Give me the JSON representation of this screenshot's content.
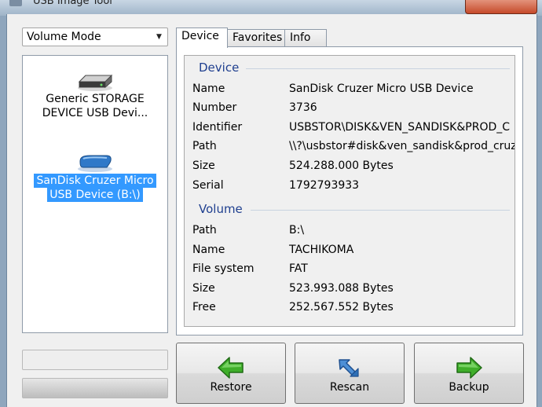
{
  "window": {
    "title": "USB Image Tool"
  },
  "mode_select": {
    "value": "Volume Mode"
  },
  "devices": [
    {
      "label_line1": "Generic STORAGE",
      "label_line2": "DEVICE USB Devi...",
      "selected": false,
      "icon": "usb-drive-gray-icon"
    },
    {
      "label_line1": "SanDisk Cruzer Micro",
      "label_line2": "USB Device (B:\\)",
      "selected": true,
      "icon": "usb-drive-blue-icon"
    }
  ],
  "tabs": [
    {
      "label": "Device",
      "active": true
    },
    {
      "label": "Favorites",
      "active": false
    },
    {
      "label": "Info",
      "active": false
    }
  ],
  "device_group": {
    "title": "Device",
    "rows": [
      {
        "label": "Name",
        "value": "SanDisk Cruzer Micro USB Device"
      },
      {
        "label": "Number",
        "value": "3736"
      },
      {
        "label": "Identifier",
        "value": "USBSTOR\\DISK&VEN_SANDISK&PROD_C"
      },
      {
        "label": "Path",
        "value": "\\\\?\\usbstor#disk&ven_sandisk&prod_cruzer_"
      },
      {
        "label": "Size",
        "value": "524.288.000 Bytes"
      },
      {
        "label": "Serial",
        "value": "1792793933"
      }
    ]
  },
  "volume_group": {
    "title": "Volume",
    "rows": [
      {
        "label": "Path",
        "value": "B:\\"
      },
      {
        "label": "Name",
        "value": "TACHIKOMA"
      },
      {
        "label": "File system",
        "value": "FAT"
      },
      {
        "label": "Size",
        "value": "523.993.088 Bytes"
      },
      {
        "label": "Free",
        "value": "252.567.552 Bytes"
      }
    ]
  },
  "buttons": {
    "restore": "Restore",
    "rescan": "Rescan",
    "backup": "Backup"
  },
  "colors": {
    "selection": "#3399ff",
    "group_title": "#1f3f8f",
    "arrow_green": "#3fae2a",
    "rescan_blue": "#4d8fd6"
  }
}
